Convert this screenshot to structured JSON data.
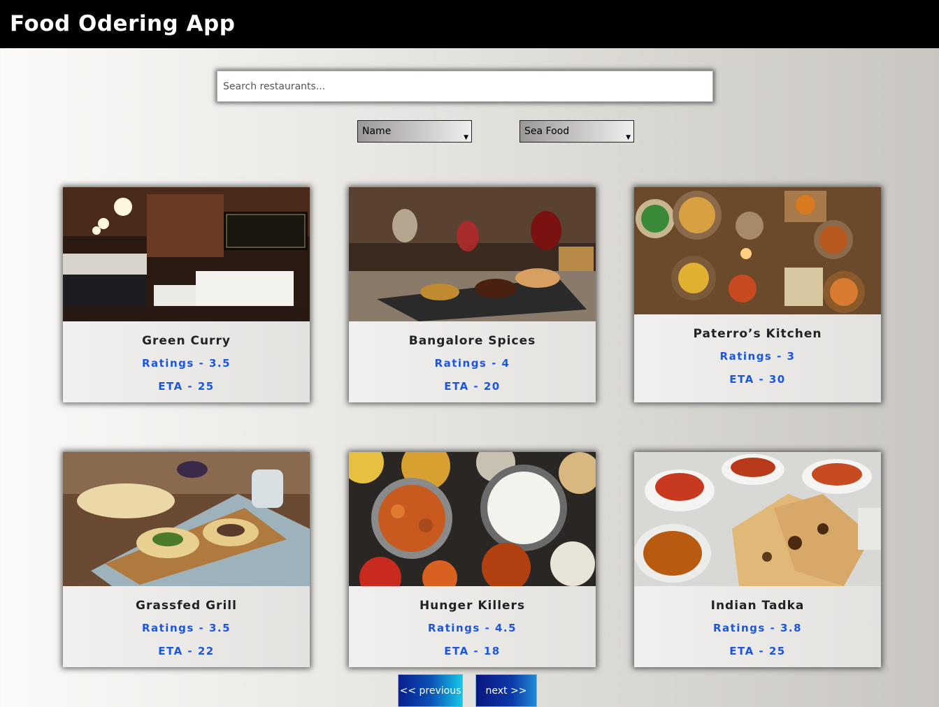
{
  "header": {
    "title": "Food Odering App"
  },
  "search": {
    "placeholder": "Search restaurants..."
  },
  "filters": {
    "sort_selected": "Name",
    "category_selected": "Sea Food"
  },
  "restaurants": [
    {
      "name": "Green Curry",
      "rating": "Ratings - 3.5",
      "eta": "ETA - 25",
      "image": "restaurant-interior"
    },
    {
      "name": "Bangalore Spices",
      "rating": "Ratings - 4",
      "eta": "ETA - 20",
      "image": "steak-dinner-wine"
    },
    {
      "name": "Paterro’s Kitchen",
      "rating": "Ratings - 3",
      "eta": "ETA - 30",
      "image": "table-spread-topview"
    },
    {
      "name": "Grassfed Grill",
      "rating": "Ratings - 3.5",
      "eta": "ETA - 22",
      "image": "wraps-on-board"
    },
    {
      "name": "Hunger Killers",
      "rating": "Ratings - 4.5",
      "eta": "ETA - 18",
      "image": "curry-and-rice"
    },
    {
      "name": "Indian Tadka",
      "rating": "Ratings - 3.8",
      "eta": "ETA - 25",
      "image": "naan-and-curries"
    }
  ],
  "pagination": {
    "previous_label": "<< previous",
    "next_label": "next >>"
  }
}
